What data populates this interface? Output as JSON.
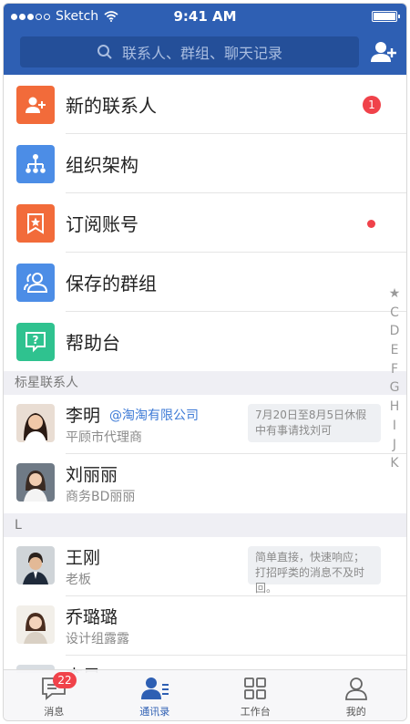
{
  "status_bar": {
    "carrier": "Sketch",
    "time": "9:41 AM"
  },
  "search": {
    "placeholder": "联系人、群组、聊天记录"
  },
  "menu": [
    {
      "label": "新的联系人",
      "icon": "add-contact-icon",
      "color": "#f26b3a",
      "badge": "1"
    },
    {
      "label": "组织架构",
      "icon": "org-chart-icon",
      "color": "#4c8de6"
    },
    {
      "label": "订阅账号",
      "icon": "bookmark-star-icon",
      "color": "#f26b3a",
      "dot": true
    },
    {
      "label": "保存的群组",
      "icon": "group-icon",
      "color": "#4c8de6"
    },
    {
      "label": "帮助台",
      "icon": "help-chat-icon",
      "color": "#2fc28f"
    }
  ],
  "sections": {
    "starred": {
      "title": "标星联系人",
      "contacts": [
        {
          "name": "李明",
          "org": "@淘淘有限公司",
          "subtitle": "平顾市代理商",
          "note": "7月20日至8月5日休假中有事请找刘可"
        },
        {
          "name": "刘丽丽",
          "subtitle": "商务BD丽丽"
        }
      ]
    },
    "l": {
      "title": "L",
      "contacts": [
        {
          "name": "王刚",
          "subtitle": "老板",
          "note": "简单直接，快速响应；打招呼类的消息不及时回。"
        },
        {
          "name": "乔璐璐",
          "subtitle": "设计组露露"
        },
        {
          "name": "李昂",
          "subtitle": ""
        }
      ]
    }
  },
  "alphabet_index": [
    "★",
    "C",
    "D",
    "E",
    "F",
    "G",
    "H",
    "I",
    "J",
    "K"
  ],
  "tabbar": [
    {
      "label": "消息",
      "icon": "message-icon",
      "badge": "22"
    },
    {
      "label": "通讯录",
      "icon": "contacts-icon",
      "active": true
    },
    {
      "label": "工作台",
      "icon": "workbench-icon"
    },
    {
      "label": "我的",
      "icon": "profile-icon"
    }
  ],
  "colors": {
    "brand": "#2e5fb3",
    "badge": "#f0424a"
  }
}
